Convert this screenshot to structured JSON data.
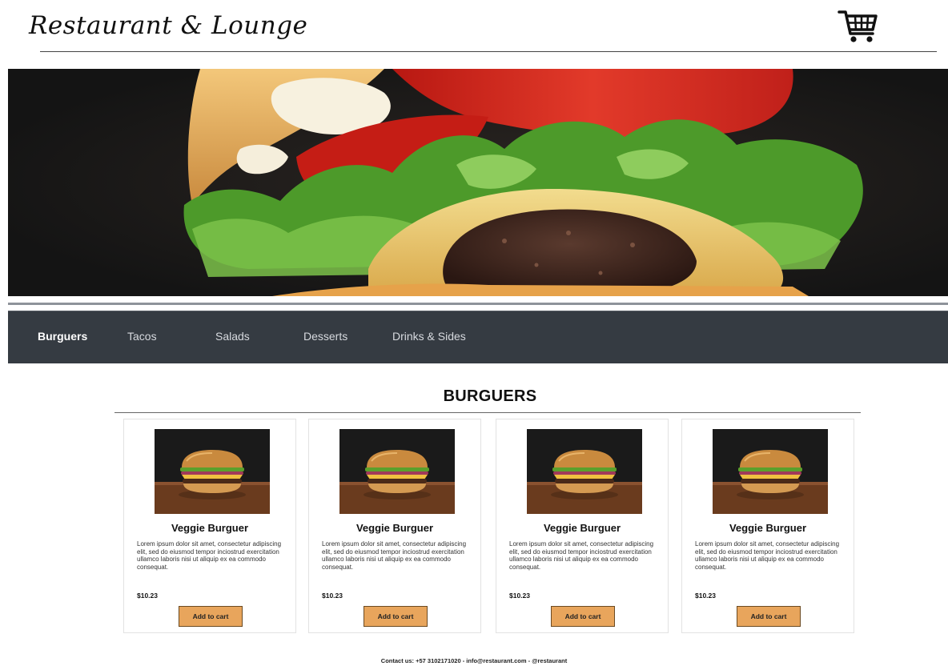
{
  "header": {
    "brand": "Restaurant & Lounge",
    "cart_icon": "shopping-cart-icon"
  },
  "hero": {
    "image": "burger-closeup-photo"
  },
  "nav": {
    "items": [
      {
        "label": "Burguers",
        "active": true
      },
      {
        "label": "Tacos",
        "active": false
      },
      {
        "label": "Salads",
        "active": false
      },
      {
        "label": "Desserts",
        "active": false
      },
      {
        "label": "Drinks & Sides",
        "active": false
      }
    ]
  },
  "section": {
    "title": "BURGUERS"
  },
  "products": [
    {
      "title": "Veggie Burguer",
      "description": "Lorem ipsum dolor sit amet, consectetur adipiscing elit, sed do eiusmod tempor inciostrud exercitation ullamco laboris nisi ut aliquip ex ea commodo consequat.",
      "price": "$10.23",
      "button": "Add to cart"
    },
    {
      "title": "Veggie Burguer",
      "description": "Lorem ipsum dolor sit amet, consectetur adipiscing elit, sed do eiusmod tempor inciostrud exercitation ullamco laboris nisi ut aliquip ex ea commodo consequat.",
      "price": "$10.23",
      "button": "Add to cart"
    },
    {
      "title": "Veggie Burguer",
      "description": "Lorem ipsum dolor sit amet, consectetur adipiscing elit, sed do eiusmod tempor inciostrud exercitation ullamco laboris nisi ut aliquip ex ea commodo consequat.",
      "price": "$10.23",
      "button": "Add to cart"
    },
    {
      "title": "Veggie Burguer",
      "description": "Lorem ipsum dolor sit amet, consectetur adipiscing elit, sed do eiusmod tempor inciostrud exercitation ullamco laboris nisi ut aliquip ex ea commodo consequat.",
      "price": "$10.23",
      "button": "Add to cart"
    }
  ],
  "footer": {
    "contact": "Contact us: +57 3102171020 - info@restaurant.com  - @restaurant"
  },
  "colors": {
    "nav_background": "#353b42",
    "button": "#e8a55c",
    "hero_background": "#1b1b1b"
  }
}
